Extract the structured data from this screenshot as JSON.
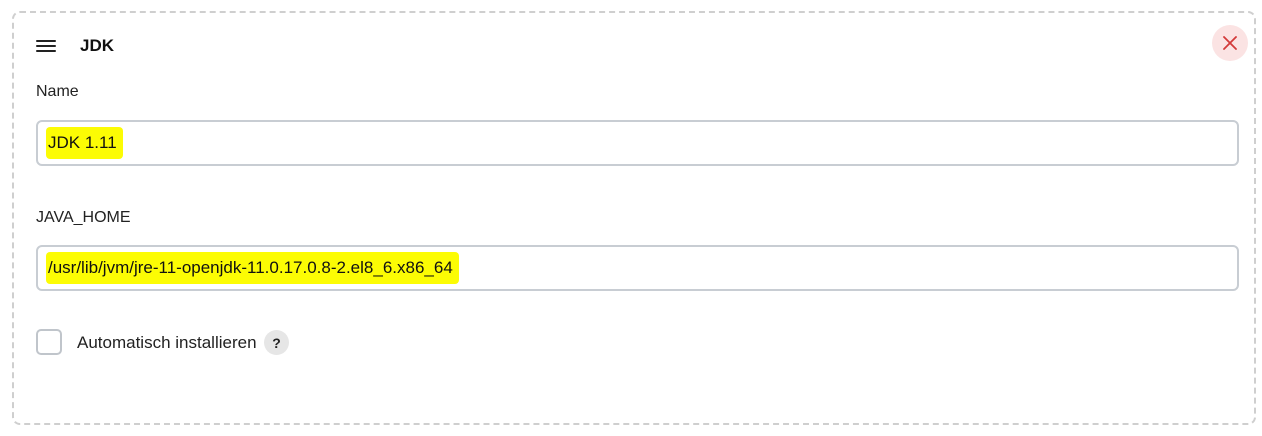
{
  "section": {
    "title": "JDK",
    "handle_icon": "hamburger-icon",
    "close_icon": "close-icon"
  },
  "fields": {
    "name": {
      "label": "Name",
      "value": "JDK 1.11"
    },
    "java_home": {
      "label": "JAVA_HOME",
      "value": "/usr/lib/jvm/jre-11-openjdk-11.0.17.0.8-2.el8_6.x86_64"
    }
  },
  "auto_install": {
    "label": "Automatisch installieren",
    "checked": false,
    "help_label": "?"
  },
  "colors": {
    "highlight": "#fcfc04",
    "close_bg": "#fbe3e3",
    "close_icon": "#d33a3a"
  }
}
